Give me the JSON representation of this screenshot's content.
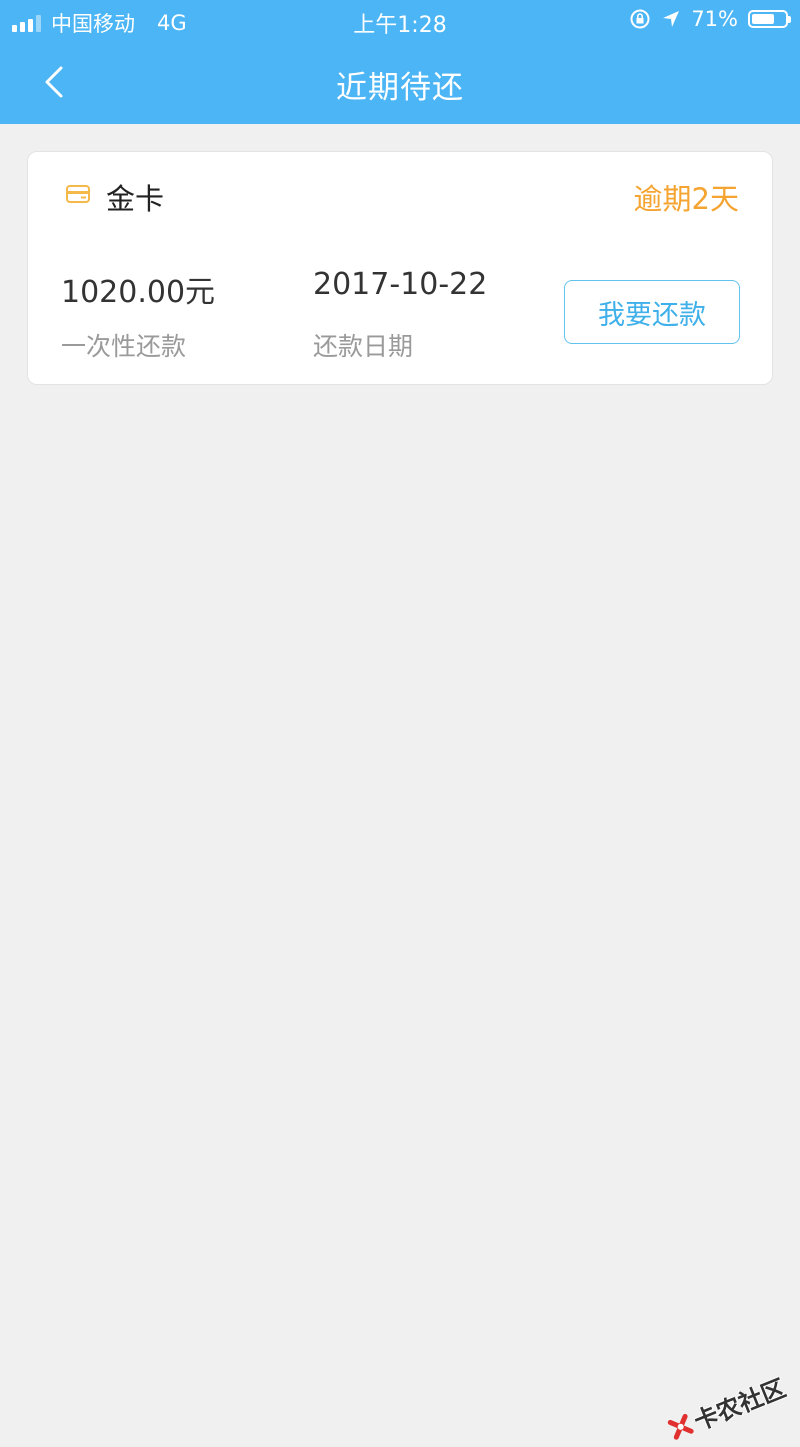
{
  "status_bar": {
    "carrier": "中国移动",
    "network": "4G",
    "time": "上午1:28",
    "battery_percent": "71%",
    "battery_level": 0.71
  },
  "nav": {
    "title": "近期待还"
  },
  "loan_card": {
    "name": "金卡",
    "overdue_text": "逾期2天",
    "amount": "1020.00元",
    "amount_label": "一次性还款",
    "date": "2017-10-22",
    "date_label": "还款日期",
    "repay_button": "我要还款"
  },
  "watermark": {
    "text": "卡农社区"
  },
  "colors": {
    "header_bg": "#4cb5f5",
    "page_bg": "#f0f0f0",
    "overdue": "#f5a431",
    "button_text": "#3fb0ea",
    "card_icon": "#f5b94a"
  }
}
